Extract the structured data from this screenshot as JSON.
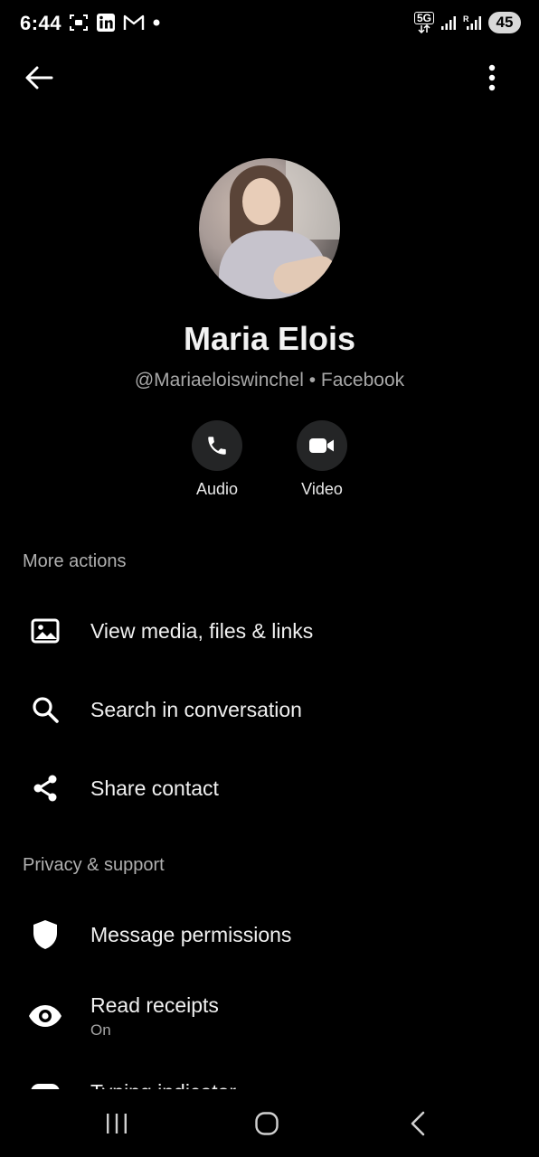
{
  "status_bar": {
    "time": "6:44",
    "left_icons": [
      "screenshot-icon",
      "linkedin-icon",
      "gmail-icon",
      "dot-icon"
    ],
    "network": "5G",
    "battery": "45"
  },
  "profile": {
    "name": "Maria Elois",
    "handle": "@Mariaeloiswinchel • Facebook"
  },
  "call_actions": [
    {
      "label": "Audio",
      "icon": "phone-icon"
    },
    {
      "label": "Video",
      "icon": "video-camera-icon"
    }
  ],
  "sections": {
    "more_actions": {
      "title": "More actions",
      "items": [
        {
          "label": "View media, files & links",
          "icon": "image-icon"
        },
        {
          "label": "Search in conversation",
          "icon": "search-icon"
        },
        {
          "label": "Share contact",
          "icon": "share-icon"
        }
      ]
    },
    "privacy_support": {
      "title": "Privacy & support",
      "items": [
        {
          "label": "Message permissions",
          "icon": "shield-icon"
        },
        {
          "label": "Read receipts",
          "sublabel": "On",
          "icon": "eye-icon"
        },
        {
          "label": "Typing indicator",
          "icon": "typing-icon"
        }
      ]
    }
  },
  "nav_bar": [
    "recent-apps-icon",
    "home-icon",
    "back-nav-icon"
  ]
}
